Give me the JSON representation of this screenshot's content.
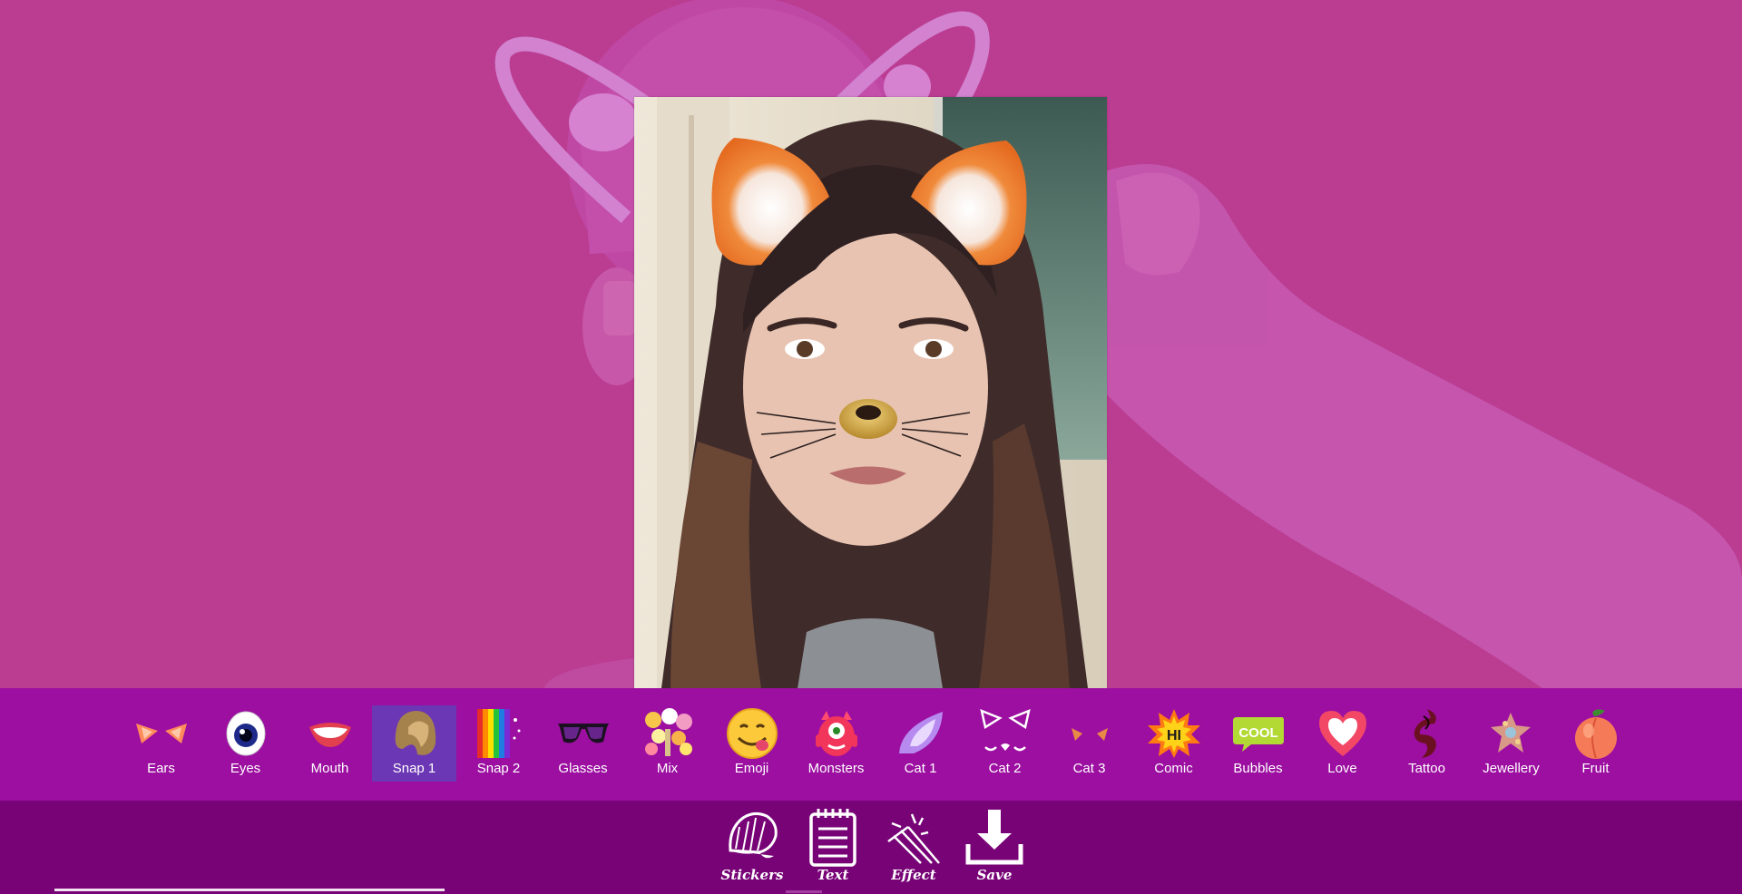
{
  "stickers": [
    {
      "id": "ears",
      "label": "Ears",
      "icon": "cat-ears-icon"
    },
    {
      "id": "eyes",
      "label": "Eyes",
      "icon": "eyeball-icon"
    },
    {
      "id": "mouth",
      "label": "Mouth",
      "icon": "smiling-lips-icon"
    },
    {
      "id": "snap1",
      "label": "Snap 1",
      "icon": "dog-ear-icon",
      "selected": true
    },
    {
      "id": "snap2",
      "label": "Snap 2",
      "icon": "rainbow-icon"
    },
    {
      "id": "glasses",
      "label": "Glasses",
      "icon": "sunglasses-icon"
    },
    {
      "id": "mix",
      "label": "Mix",
      "icon": "flower-crown-icon"
    },
    {
      "id": "emoji",
      "label": "Emoji",
      "icon": "yum-emoji-icon"
    },
    {
      "id": "monsters",
      "label": "Monsters",
      "icon": "monster-icon"
    },
    {
      "id": "cat1",
      "label": "Cat 1",
      "icon": "purple-ear-icon"
    },
    {
      "id": "cat2",
      "label": "Cat 2",
      "icon": "cat-outline-icon"
    },
    {
      "id": "cat3",
      "label": "Cat 3",
      "icon": "small-cat-ears-icon"
    },
    {
      "id": "comic",
      "label": "Comic",
      "icon": "comic-hi-icon",
      "text": "HI"
    },
    {
      "id": "bubbles",
      "label": "Bubbles",
      "icon": "cool-bubble-icon",
      "text": "COOL"
    },
    {
      "id": "love",
      "label": "Love",
      "icon": "heart-icon"
    },
    {
      "id": "tattoo",
      "label": "Tattoo",
      "icon": "dragon-tattoo-icon"
    },
    {
      "id": "jewellery",
      "label": "Jewellery",
      "icon": "brooch-icon"
    },
    {
      "id": "fruit",
      "label": "Fruit",
      "icon": "peach-icon"
    }
  ],
  "actions": [
    {
      "id": "stickers",
      "label": "Stickers",
      "icon": "sticker-shell-icon"
    },
    {
      "id": "text",
      "label": "Text",
      "icon": "notepad-icon"
    },
    {
      "id": "effect",
      "label": "Effect",
      "icon": "magic-wand-icon"
    },
    {
      "id": "save",
      "label": "Save",
      "icon": "download-icon"
    }
  ],
  "colors": {
    "background": "#bb3d92",
    "sticker_bar": "#9c0fa0",
    "selected": "#6c37b4",
    "action_bar": "#780377"
  }
}
